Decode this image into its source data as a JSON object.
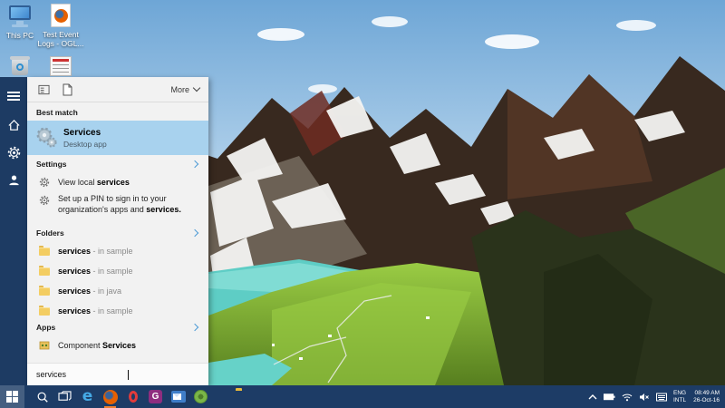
{
  "desktop": {
    "icons": [
      {
        "label": "This PC"
      },
      {
        "label": "Test Event Logs - OGL..."
      }
    ]
  },
  "search_flyout": {
    "filter_bar": {
      "more_label": "More"
    },
    "best_match": {
      "header": "Best match",
      "title": "Services",
      "subtitle": "Desktop app"
    },
    "settings": {
      "header": "Settings",
      "item1": {
        "prefix": "View local ",
        "bold": "services"
      },
      "item2": {
        "line1": "Set up a PIN to sign in to your",
        "line2_prefix": "organization's apps and ",
        "line2_bold": "services."
      }
    },
    "folders": {
      "header": "Folders",
      "items": [
        {
          "bold": "services",
          "suffix": " - in sample"
        },
        {
          "bold": "services",
          "suffix": " - in sample"
        },
        {
          "bold": "services",
          "suffix": " - in java"
        },
        {
          "bold": "services",
          "suffix": " - in sample"
        }
      ]
    },
    "apps": {
      "header": "Apps",
      "item1": {
        "prefix": "Component ",
        "bold": "Services"
      }
    },
    "search_box": {
      "value": "services"
    }
  },
  "taskbar": {
    "tray": {
      "language_line1": "ENG",
      "language_line2": "INTL",
      "time": "08:49 AM",
      "date": "26-Oct-16"
    }
  },
  "colors": {
    "taskbar_navy": "#1d3c66",
    "rail_navy": "#1d3b63",
    "highlight_blue": "#a8d2ee",
    "chevron_blue": "#4f9cd6",
    "lake_turquoise": "#5ecdc5",
    "meadow_green": "#86b83a"
  }
}
